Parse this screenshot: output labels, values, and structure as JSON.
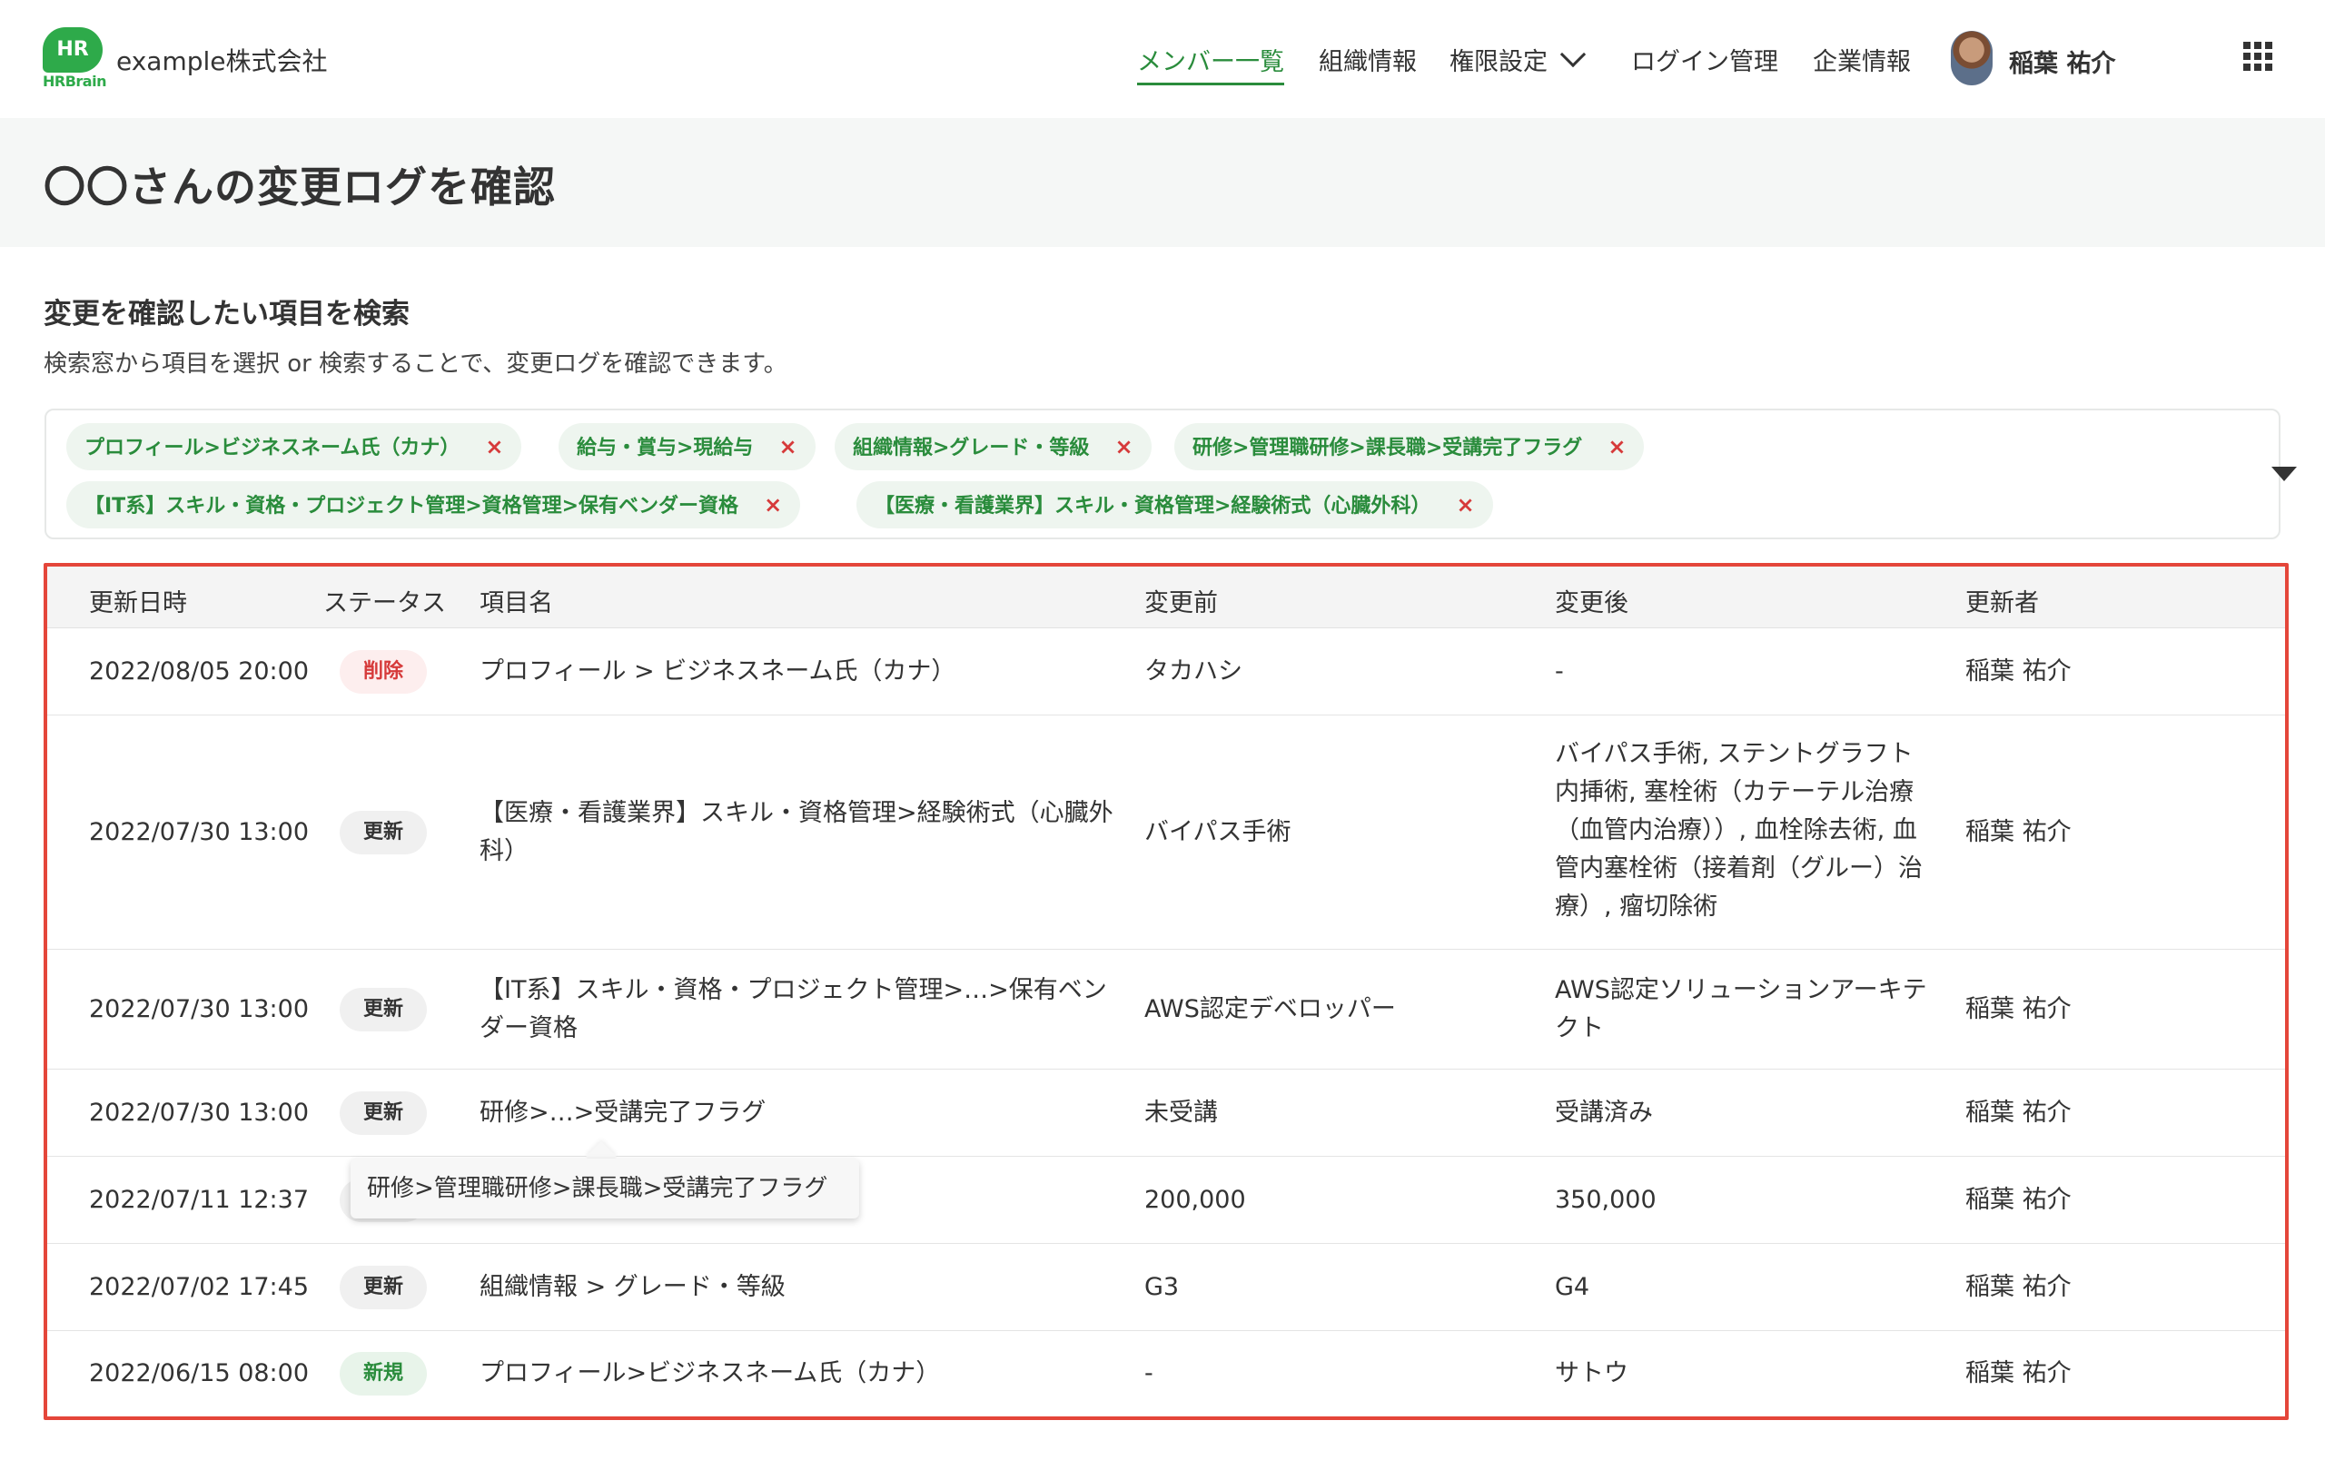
{
  "header": {
    "logo_mark": "HR",
    "logo_text": "HRBrain",
    "company": "example株式会社",
    "nav": [
      "メンバー一覧",
      "組織情報",
      "権限設定",
      "ログイン管理",
      "企業情報"
    ],
    "user_name": "稲葉 祐介"
  },
  "page": {
    "title": "〇〇さんの変更ログを確認"
  },
  "search": {
    "heading": "変更を確認したい項目を検索",
    "description": "検索窓から項目を選択 or 検索することで、変更ログを確認できます。",
    "tags": [
      "プロフィール>ビジネスネーム氏（カナ）",
      "給与・賞与>現給与",
      "組織情報>グレード・等級",
      "研修>管理職研修>課長職>受講完了フラグ",
      "【IT系】スキル・資格・プロジェクト管理>資格管理>保有ベンダー資格",
      "【医療・看護業界】スキル・資格管理>経験術式（心臓外科）"
    ],
    "remove_glyph": "×"
  },
  "table": {
    "headers": [
      "更新日時",
      "ステータス",
      "項目名",
      "変更前",
      "変更後",
      "更新者"
    ],
    "rows": [
      {
        "date": "2022/08/05 20:00",
        "status": "削除",
        "item": "プロフィール > ビジネスネーム氏（カナ）",
        "before": "タカハシ",
        "after": "-",
        "user": "稲葉 祐介"
      },
      {
        "date": "2022/07/30 13:00",
        "status": "更新",
        "item": "【医療・看護業界】スキル・資格管理>経験術式（心臓外科）",
        "before": "バイパス手術",
        "after": "バイパス手術, ステントグラフト内挿術, 塞栓術（カテーテル治療（血管内治療））, 血栓除去術, 血管内塞栓術（接着剤（グルー）治療）, 瘤切除術",
        "user": "稲葉 祐介"
      },
      {
        "date": "2022/07/30 13:00",
        "status": "更新",
        "item": "【IT系】スキル・資格・プロジェクト管理>…>保有ベンダー資格",
        "before": "AWS認定デベロッパー",
        "after": "AWS認定ソリューションアーキテクト",
        "user": "稲葉 祐介"
      },
      {
        "date": "2022/07/30 13:00",
        "status": "更新",
        "item": "研修>…>受講完了フラグ",
        "before": "未受講",
        "after": "受講済み",
        "user": "稲葉 祐介"
      },
      {
        "date": "2022/07/11 12:37",
        "status": "",
        "item": "",
        "before": "200,000",
        "after": "350,000",
        "user": "稲葉 祐介"
      },
      {
        "date": "2022/07/02 17:45",
        "status": "更新",
        "item": "組織情報 > グレード・等級",
        "before": "G3",
        "after": "G4",
        "user": "稲葉 祐介"
      },
      {
        "date": "2022/06/15 08:00",
        "status": "新規",
        "item": "プロフィール>ビジネスネーム氏（カナ）",
        "before": "-",
        "after": "サトウ",
        "user": "稲葉 祐介"
      }
    ],
    "tooltip": "研修>管理職研修>課長職>受講完了フラグ"
  },
  "colors": {
    "brand": "#2eaa4a",
    "active_nav": "#2a8c3c",
    "highlight_border": "#e4463a",
    "delete": "#d63a3a"
  }
}
